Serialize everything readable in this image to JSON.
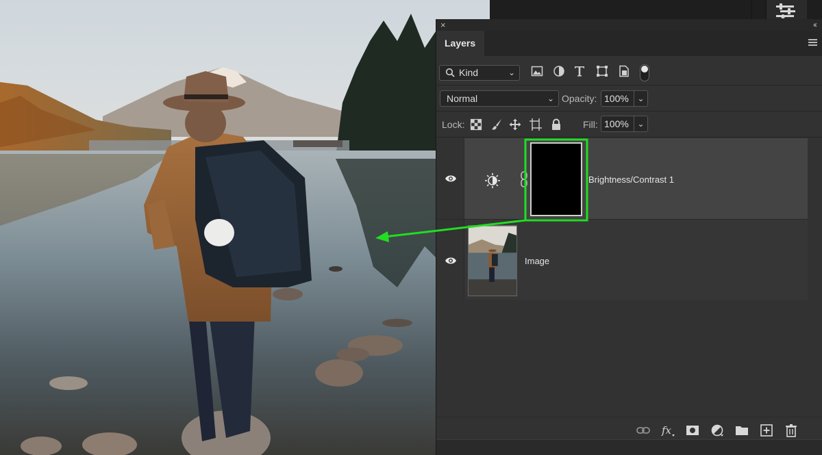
{
  "panel": {
    "tab_label": "Layers",
    "filter": {
      "kind_label": "Kind",
      "icons": [
        "image-filter-icon",
        "adjustment-filter-icon",
        "type-filter-icon",
        "shape-filter-icon",
        "smart-object-filter-icon"
      ]
    },
    "blend_mode": "Normal",
    "opacity_label": "Opacity:",
    "opacity_value": "100%",
    "lock_label": "Lock:",
    "lock_icons": [
      "lock-transparent-pixels-icon",
      "lock-image-pixels-icon",
      "lock-position-icon",
      "lock-artboard-icon",
      "lock-all-icon"
    ],
    "fill_label": "Fill:",
    "fill_value": "100%"
  },
  "layers": [
    {
      "name": "Brightness/Contrast 1",
      "type": "adjustment",
      "visible": true,
      "selected": true
    },
    {
      "name": "Image",
      "type": "pixel",
      "visible": true,
      "selected": false
    }
  ],
  "footer_icons": [
    "link-layers-icon",
    "fx-icon",
    "add-mask-icon",
    "new-adjustment-icon",
    "new-group-icon",
    "new-layer-icon",
    "delete-layer-icon"
  ],
  "colors": {
    "highlight": "#22dd22",
    "panel_bg": "#323232",
    "selected_row": "#444444"
  }
}
